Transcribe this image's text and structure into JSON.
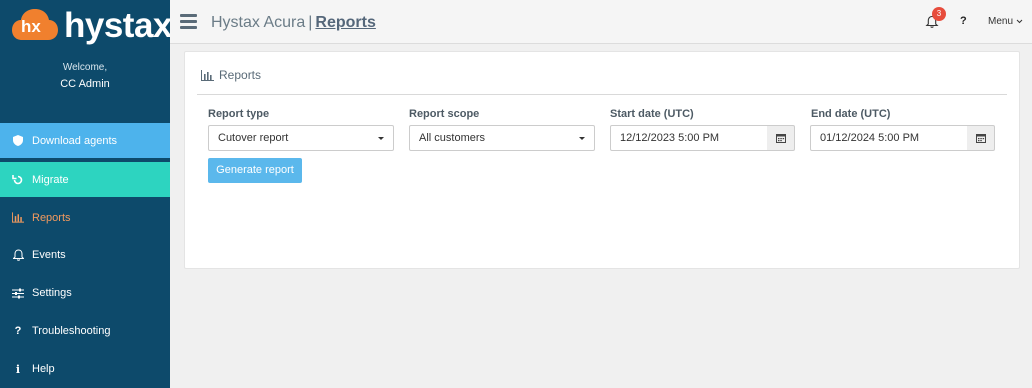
{
  "brand": {
    "name": "hystax",
    "mark": "hx",
    "accent": "#f0802e"
  },
  "sidebar": {
    "welcome": "Welcome,",
    "user": "CC Admin",
    "items": [
      {
        "label": "Download agents",
        "icon": "shield-icon"
      },
      {
        "label": "Migrate",
        "icon": "refresh-icon"
      },
      {
        "label": "Reports",
        "icon": "bar-chart-icon"
      },
      {
        "label": "Events",
        "icon": "bell-icon"
      },
      {
        "label": "Settings",
        "icon": "sliders-icon"
      },
      {
        "label": "Troubleshooting",
        "icon": "question-icon"
      },
      {
        "label": "Help",
        "icon": "info-icon"
      }
    ]
  },
  "header": {
    "app_name": "Hystax Acura",
    "separator": "|",
    "current_page": "Reports",
    "notification_count": "3",
    "help": "?",
    "menu": "Menu"
  },
  "panel": {
    "title": "Reports",
    "fields": {
      "report_type": {
        "label": "Report type",
        "value": "Cutover report"
      },
      "report_scope": {
        "label": "Report scope",
        "value": "All customers"
      },
      "start_date": {
        "label": "Start date (UTC)",
        "value": "12/12/2023 5:00 PM"
      },
      "end_date": {
        "label": "End date (UTC)",
        "value": "01/12/2024 5:00 PM"
      }
    },
    "generate_label": "Generate report"
  },
  "colors": {
    "sidebar_bg": "#0d4a6b",
    "download_active": "#4db3ec",
    "migrate_active": "#2dd4c0",
    "reports_text": "#f39a5e",
    "button": "#5bb8ec",
    "badge": "#e74c3c"
  }
}
